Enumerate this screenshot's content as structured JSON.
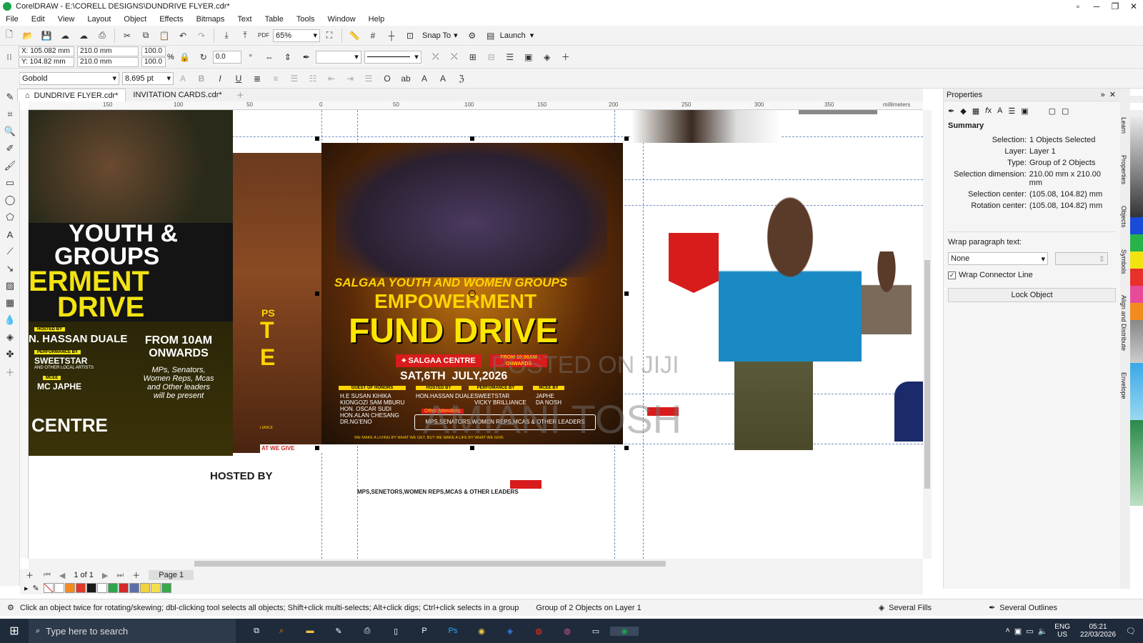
{
  "window": {
    "title": "CorelDRAW - E:\\CORELL DESIGNS\\DUNDRIVE FLYER.cdr*"
  },
  "menu": [
    "File",
    "Edit",
    "View",
    "Layout",
    "Object",
    "Effects",
    "Bitmaps",
    "Text",
    "Table",
    "Tools",
    "Window",
    "Help"
  ],
  "toolbar": {
    "zoom": "65%",
    "snap_to": "Snap To",
    "launch": "Launch"
  },
  "propbar": {
    "x": "X: 105.082 mm",
    "y": "Y: 104.82 mm",
    "w": "210.0 mm",
    "h": "210.0 mm",
    "sx": "100.0",
    "sy": "100.0",
    "pct": "%",
    "angle": "0.0"
  },
  "textbar": {
    "font": "Gobold",
    "size": "8.695 pt"
  },
  "tabs": [
    "DUNDRIVE FLYER.cdr*",
    "INVITATION CARDS.cdr*"
  ],
  "ruler": {
    "ticks": [
      "150",
      "100",
      "50",
      "0",
      "50",
      "100",
      "150",
      "200",
      "250",
      "300",
      "350"
    ],
    "unit": "millimeters"
  },
  "canvas": {
    "left_flyer": {
      "line1": "YOUTH &",
      "line2": "GROUPS",
      "line3": "ERMENT",
      "line4": "DRIVE",
      "hosted_label": "HOSTED BY",
      "host": "N. HASSAN DUALE",
      "performance_label": "PERFORMANCE BY",
      "performer": "SWEETSTAR",
      "performer_sub": "AND OTHER LOCAL ARTISTS",
      "mcee_label": "MCEE",
      "mc": "MC JAPHE",
      "time": "FROM 10AM ONWARDS",
      "guests": "MPs, Senators, Women Reps, Mcas and Other leaders will be present",
      "venue": "CENTRE"
    },
    "back_flyer": {
      "frag1": "PS",
      "frag2": "T",
      "frag3": "E",
      "footer": "AT WE GIVE",
      "frag4": "LIANCE"
    },
    "main_flyer": {
      "subtitle": "SALGAA YOUTH AND WOMEN GROUPS",
      "line1": "EMPOWERMENT",
      "line2": "FUND DRIVE",
      "venue": "SALGAA CENTRE",
      "time": "FROM 10:00AM ONWARDS",
      "date": "SAT,6TH  JULY,2026",
      "col1_label": "GUEST OF HONORS",
      "col1": "H.E SUSAN KIHIKA\nKIONGOZI SAM MBURU\nHON. OSCAR SUDI\nHON.ALAN CHESANG\nDR.NG'ENO",
      "col2_label": "HOSTED BY",
      "col2": "HON.HASSAN DUALE",
      "col3_label": "PERFOMANCE BY",
      "col3": "SWEETSTAR\nVICKY BRILLIANCE",
      "col4_label": "MCEE BY",
      "col4": "JAPHE\nDA NOSH",
      "attendees_label": "Other Attendees",
      "attendees": "MPS,SENATORS,WOMEN REPS,MCAS & OTHER LEADERS",
      "footer": "WE MAKE A LIVING BY WHAT WE GET, BUT WE MAKE A LIFE BY WHAT WE GIVE"
    },
    "watermark1": "POSTED ON JIJI",
    "watermark2": "AMIANI TOSH",
    "hosted_by_text": "HOSTED BY",
    "leaders_text": "MPS,SENETORS,WOMEN REPS,MCAS & OTHER LEADERS"
  },
  "pagenav": {
    "of": "1 of 1",
    "page": "Page 1"
  },
  "palette": [
    "#ffffff",
    "#f28c1e",
    "#e0392b",
    "#1a1a1a",
    "#ffffff",
    "#2ea44f",
    "#d42a2a",
    "#5a6fa8",
    "#f0d23a",
    "#f4e04d",
    "#3aa84a"
  ],
  "properties": {
    "header": "Properties",
    "section": "Summary",
    "rows": [
      {
        "k": "Selection:",
        "v": "1 Objects Selected"
      },
      {
        "k": "Layer:",
        "v": "Layer 1"
      },
      {
        "k": "Type:",
        "v": "Group of 2 Objects"
      },
      {
        "k": "Selection dimension:",
        "v": "210.00 mm x 210.00 mm"
      },
      {
        "k": "Selection center:",
        "v": "(105.08, 104.82) mm"
      },
      {
        "k": "Rotation center:",
        "v": "(105.08, 104.82) mm"
      }
    ],
    "wrap_label": "Wrap paragraph text:",
    "wrap_value": "None",
    "wrap_connector": "Wrap Connector Line",
    "lock_button": "Lock Object"
  },
  "dockers": [
    "Learn",
    "Properties",
    "Objects",
    "Symbols",
    "Align and Distribute",
    "Envelope"
  ],
  "status": {
    "hint": "Click an object twice for rotating/skewing; dbl-clicking tool selects all objects; Shift+click multi-selects; Alt+click digs; Ctrl+click selects in a group",
    "object": "Group of 2 Objects on Layer 1",
    "fills": "Several Fills",
    "outlines": "Several Outlines"
  },
  "taskbar": {
    "search": "Type here to search",
    "lang": "ENG",
    "region": "US",
    "time": "05:21",
    "date": "22/03/2026"
  }
}
